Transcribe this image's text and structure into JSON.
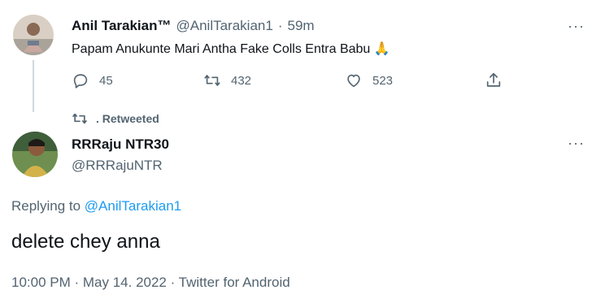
{
  "top_tweet": {
    "display_name": "Anil Tarakian™",
    "handle": "@AnilTarakian1",
    "separator": "·",
    "time": "59m",
    "text": "Papam Anukunte Mari Antha Fake Colls Entra Babu",
    "emoji": "🙏",
    "replies": "45",
    "retweets": "432",
    "likes": "523",
    "more": "···"
  },
  "retweet_context": {
    "label": "Retweeted"
  },
  "main_tweet": {
    "display_name": "RRRaju NTR30",
    "handle": "@RRRajuNTR",
    "more": "···",
    "replying_prefix": "Replying to",
    "replying_to": "@AnilTarakian1",
    "text": "delete chey anna",
    "timestamp": "10:00 PM · May 14. 2022 · Twitter for Android"
  },
  "colors": {
    "accent": "#1d9bf0",
    "muted": "#536471",
    "text": "#0f1419"
  }
}
